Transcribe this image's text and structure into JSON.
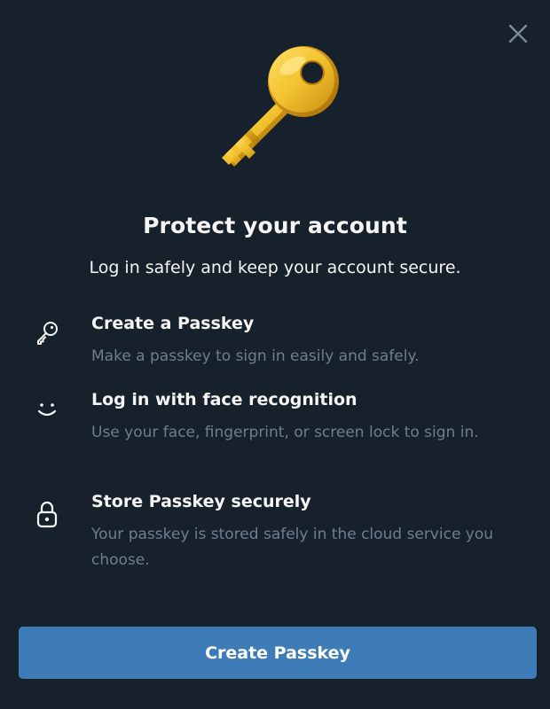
{
  "dialog": {
    "close_icon": "close-icon",
    "hero_icon": "golden-key-icon",
    "title": "Protect your account",
    "subtitle": "Log in safely and keep your account secure.",
    "features": [
      {
        "icon": "key-icon",
        "title": "Create a Passkey",
        "description": "Make a passkey to sign in easily and safely."
      },
      {
        "icon": "smile-face-icon",
        "title": "Log in with face recognition",
        "description": "Use your face, fingerprint, or screen lock to sign in."
      },
      {
        "icon": "lock-icon",
        "title": "Store Passkey securely",
        "description": "Your passkey is stored safely in the cloud service you choose."
      }
    ],
    "cta_label": "Create Passkey"
  },
  "colors": {
    "background": "#17212b",
    "primary_text": "#f5f5f5",
    "secondary_text": "#6d7f8f",
    "button": "#3e7cb8",
    "key_gold": "#f2c12e"
  }
}
